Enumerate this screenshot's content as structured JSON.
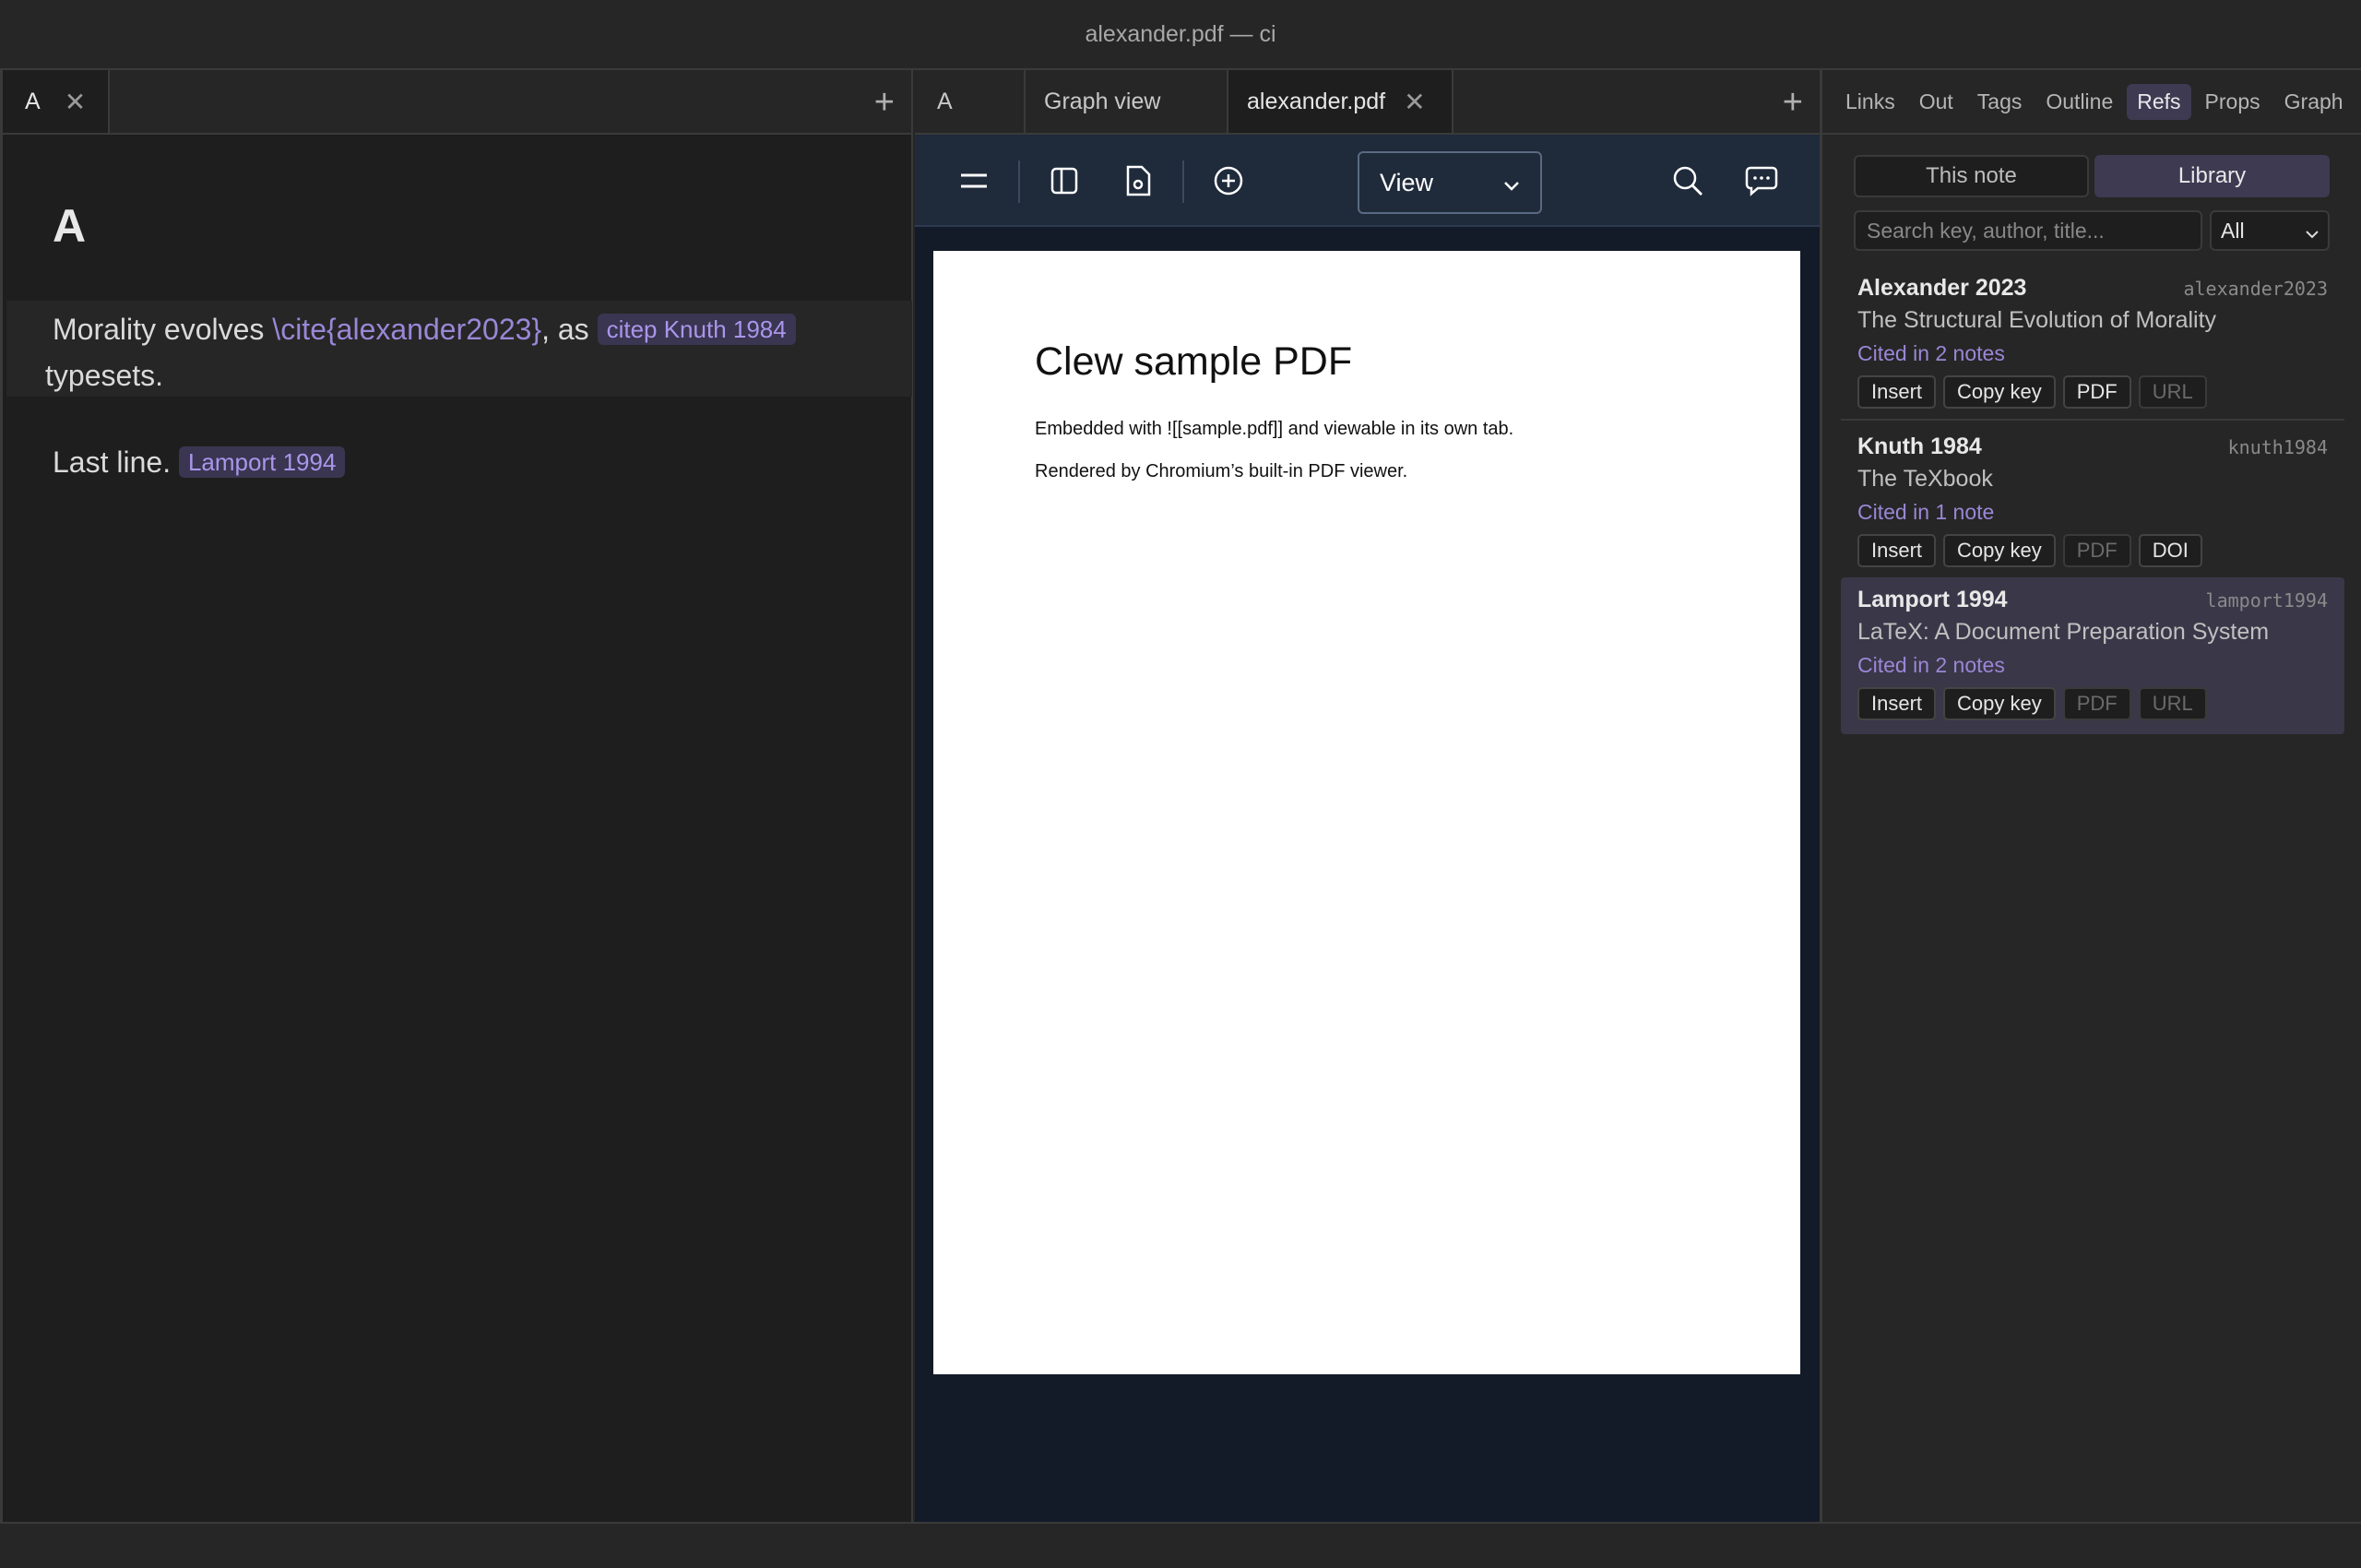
{
  "window": {
    "title": "alexander.pdf — ci"
  },
  "left_pane": {
    "tab": {
      "label": "A"
    },
    "note": {
      "heading": "A",
      "para_start": "Morality evolves ",
      "cite_raw": "\\cite{alexander2023}",
      "para_mid": ", as ",
      "pill_citep": "citep Knuth 1984",
      "para_end": " typesets.",
      "last_line": "Last line.",
      "pill_lamport": "Lamport 1994"
    }
  },
  "center_pane": {
    "tabs": [
      {
        "label": "A"
      },
      {
        "label": "Graph view"
      },
      {
        "label": "alexander.pdf"
      }
    ],
    "toolbar": {
      "view_label": "View"
    },
    "pdf": {
      "title": "Clew sample PDF",
      "line1": "Embedded with ![[sample.pdf]] and viewable in its own tab.",
      "line2": "Rendered by Chromium’s built-in PDF viewer."
    }
  },
  "right_pane": {
    "tabs": [
      "Links",
      "Out",
      "Tags",
      "Outline",
      "Refs",
      "Props",
      "Graph"
    ],
    "active_tab": "Refs",
    "segments": {
      "this_note": "This note",
      "library": "Library"
    },
    "search": {
      "placeholder": "Search key, author, title...",
      "filter": "All"
    },
    "refs": [
      {
        "name": "Alexander 2023",
        "key": "alexander2023",
        "title": "The Structural Evolution of Morality",
        "cited": "Cited in 2 notes",
        "actions": [
          "Insert",
          "Copy key",
          "PDF",
          "URL"
        ]
      },
      {
        "name": "Knuth 1984",
        "key": "knuth1984",
        "title": "The TeXbook",
        "cited": "Cited in 1 note",
        "actions": [
          "Insert",
          "Copy key",
          "PDF",
          "DOI"
        ]
      },
      {
        "name": "Lamport 1994",
        "key": "lamport1994",
        "title": "LaTeX: A Document Preparation System",
        "cited": "Cited in 2 notes",
        "actions": [
          "Insert",
          "Copy key",
          "PDF",
          "URL"
        ]
      }
    ]
  },
  "colors": {
    "accent": "#9a87d6",
    "pill_bg": "#3a3550",
    "pdf_toolbar": "#1f2a3b",
    "pdf_bg": "#131a28"
  }
}
